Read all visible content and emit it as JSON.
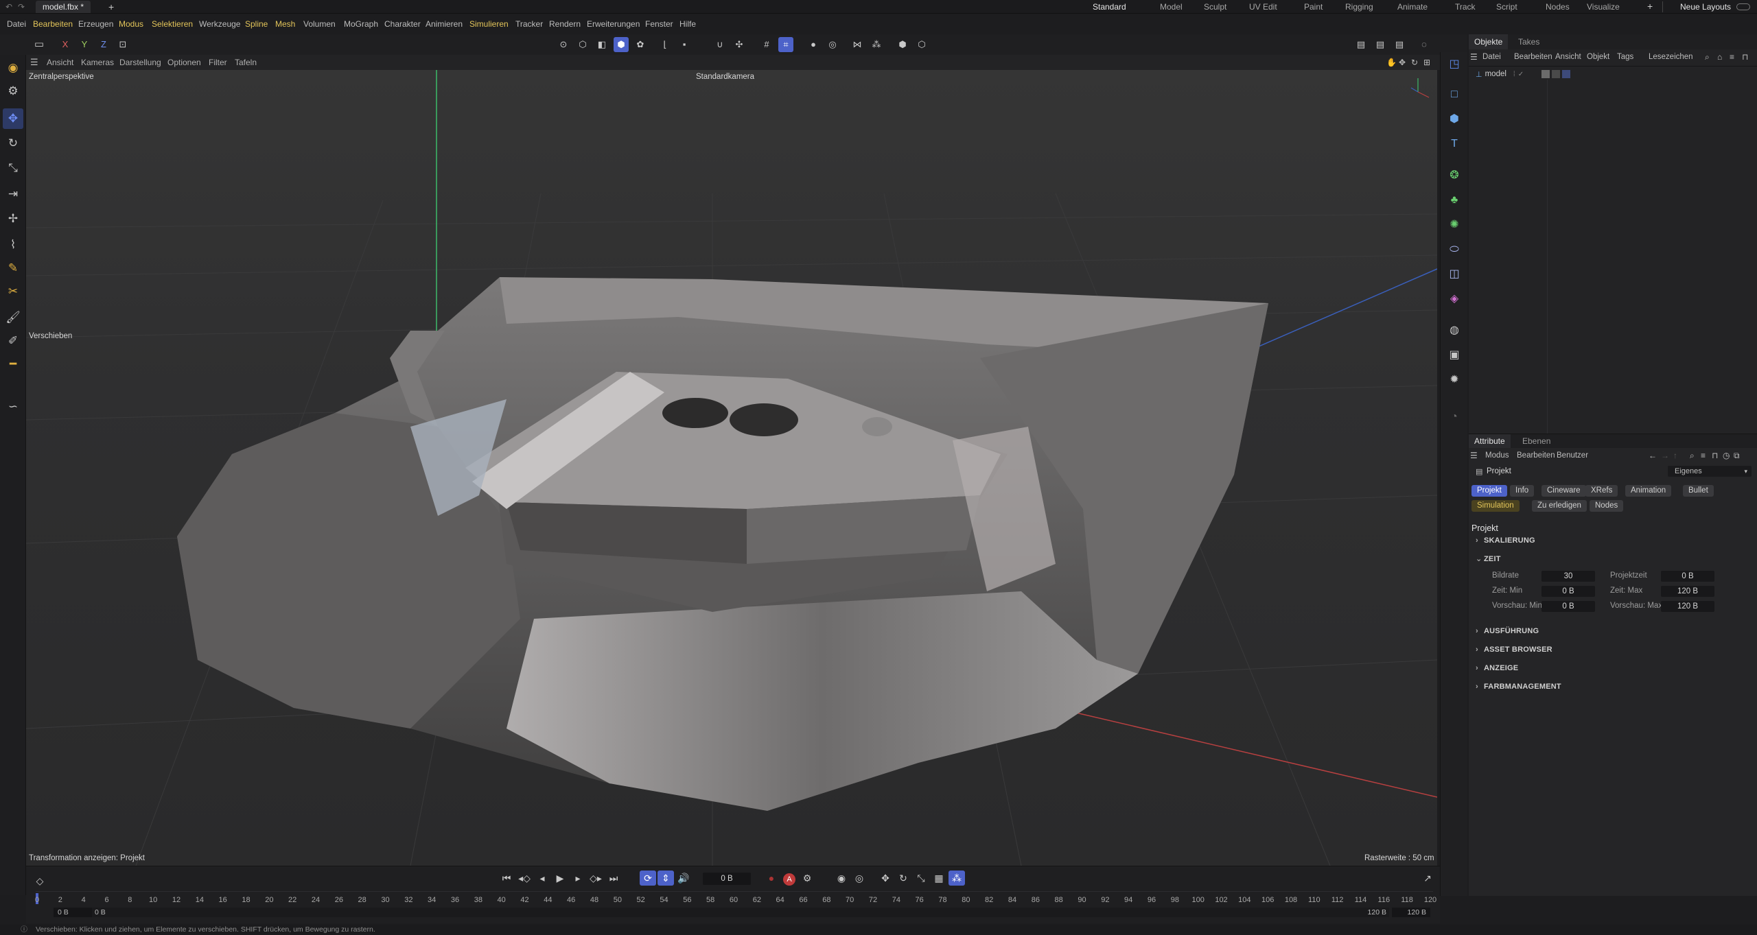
{
  "titlebar": {
    "doc_tab": "model.fbx *",
    "add_tab": "+",
    "layouts": [
      "Standard",
      "Model",
      "Sculpt",
      "UV Edit",
      "Paint",
      "Rigging",
      "Animate",
      "Track",
      "Script",
      "Nodes",
      "Visualize"
    ],
    "add_layout": "+",
    "new_layouts": "Neue Layouts"
  },
  "menubar": [
    "Datei",
    "Bearbeiten",
    "Erzeugen",
    "Modus",
    "Selektieren",
    "Werkzeuge",
    "Spline",
    "Mesh",
    "Volumen",
    "MoGraph",
    "Charakter",
    "Animieren",
    "Simulieren",
    "Tracker",
    "Rendern",
    "Erweiterungen",
    "Fenster",
    "Hilfe"
  ],
  "axis_buttons": [
    "X",
    "Y",
    "Z"
  ],
  "viewport_menu": [
    "Ansicht",
    "Kameras",
    "Darstellung",
    "Optionen",
    "Filter",
    "Tafeln"
  ],
  "viewport": {
    "perspective": "Zentralperspektive",
    "camera": "Standardkamera",
    "tool_hint": "Verschieben",
    "transform_label": "Transformation anzeigen: Projekt",
    "grid_label": "Rasterweite : 50 cm"
  },
  "objects_panel": {
    "tabs": [
      "Objekte",
      "Takes"
    ],
    "menu": [
      "Datei",
      "Bearbeiten",
      "Ansicht",
      "Objekt",
      "Tags",
      "Lesezeichen"
    ],
    "items": [
      {
        "name": "model"
      }
    ]
  },
  "attributes_panel": {
    "tabs": [
      "Attribute",
      "Ebenen"
    ],
    "menu": [
      "Modus",
      "Bearbeiten",
      "Benutzer"
    ],
    "object_type": "Projekt",
    "preset": "Eigenes",
    "pills_row1": [
      "Projekt",
      "Info",
      "Cineware",
      "XRefs",
      "Animation",
      "Bullet"
    ],
    "pills_row2": [
      "Simulation",
      "Zu erledigen",
      "Nodes"
    ],
    "heading": "Projekt",
    "sections": [
      "SKALIERUNG",
      "ZEIT",
      "AUSFÜHRUNG",
      "ASSET BROWSER",
      "ANZEIGE",
      "FARBMANAGEMENT"
    ],
    "fields": [
      {
        "label": "Bildrate",
        "value": "30",
        "label2": "Projektzeit",
        "value2": "0 B"
      },
      {
        "label": "Zeit: Min",
        "value": "0 B",
        "label2": "Zeit: Max",
        "value2": "120 B"
      },
      {
        "label": "Vorschau: Min",
        "value": "0 B",
        "label2": "Vorschau: Max",
        "value2": "120 B"
      }
    ]
  },
  "timeline": {
    "current_frame": "0 B",
    "ticks": [
      "0",
      "2",
      "4",
      "6",
      "8",
      "10",
      "12",
      "14",
      "16",
      "18",
      "20",
      "22",
      "24",
      "26",
      "28",
      "30",
      "32",
      "34",
      "36",
      "38",
      "40",
      "42",
      "44",
      "46",
      "48",
      "50",
      "52",
      "54",
      "56",
      "58",
      "60",
      "62",
      "64",
      "66",
      "68",
      "70",
      "72",
      "74",
      "76",
      "78",
      "80",
      "82",
      "84",
      "86",
      "88",
      "90",
      "92",
      "94",
      "96",
      "98",
      "100",
      "102",
      "104",
      "106",
      "108",
      "110",
      "112",
      "114",
      "116",
      "118",
      "120"
    ],
    "range_start": "0 B",
    "range_start2": "0 B",
    "range_end": "120 B",
    "range_end2": "120 B"
  },
  "statusbar": {
    "text": "Verschieben: Klicken und ziehen, um Elemente zu verschieben. SHIFT drücken, um Bewegung zu rastern."
  }
}
